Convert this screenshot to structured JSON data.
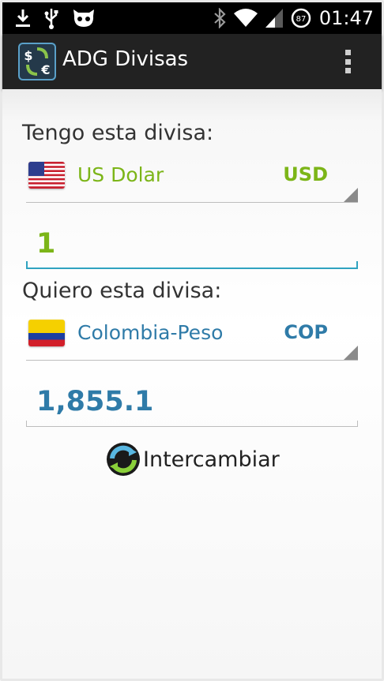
{
  "status_bar": {
    "time": "01:47",
    "battery_level": "87",
    "icons": [
      "download-icon",
      "usb-icon",
      "cyanogen-mod-icon",
      "bluetooth-icon",
      "wifi-icon",
      "signal-icon",
      "battery-icon"
    ]
  },
  "action_bar": {
    "title": "ADG Divisas",
    "overflow_icon": "overflow-menu-icon"
  },
  "from": {
    "label": "Tengo esta divisa:",
    "currency_name": "US Dolar",
    "currency_code": "USD",
    "amount": "1",
    "color": "#7cb518",
    "flag_icon": "us-flag-icon"
  },
  "to": {
    "label": "Quiero esta divisa:",
    "currency_name": "Colombia-Peso",
    "currency_code": "COP",
    "amount": "1,855.1",
    "color": "#2f7ba8",
    "flag_icon": "colombia-flag-icon"
  },
  "swap": {
    "label": "Intercambiar",
    "icon": "swap-arrows-icon"
  }
}
